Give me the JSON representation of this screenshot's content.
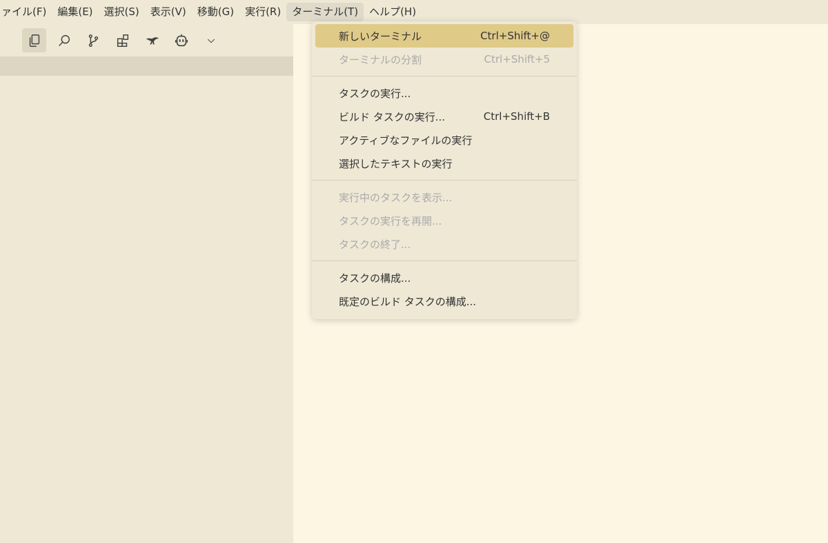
{
  "menubar": {
    "items": [
      {
        "label": "ァイル(F)"
      },
      {
        "label": "編集(E)"
      },
      {
        "label": "選択(S)"
      },
      {
        "label": "表示(V)"
      },
      {
        "label": "移動(G)"
      },
      {
        "label": "実行(R)"
      },
      {
        "label": "ターミナル(T)"
      },
      {
        "label": "ヘルプ(H)"
      }
    ]
  },
  "activity_icons": [
    "explorer-icon",
    "search-icon",
    "source-control-icon",
    "extensions-icon",
    "kangaroo-icon",
    "robot-icon",
    "chevron-down-icon"
  ],
  "terminal_menu": {
    "groups": [
      [
        {
          "label": "新しいターミナル",
          "shortcut": "Ctrl+Shift+@",
          "enabled": true,
          "highlighted": true
        },
        {
          "label": "ターミナルの分割",
          "shortcut": "Ctrl+Shift+5",
          "enabled": false
        }
      ],
      [
        {
          "label": "タスクの実行...",
          "shortcut": "",
          "enabled": true
        },
        {
          "label": "ビルド タスクの実行...",
          "shortcut": "Ctrl+Shift+B",
          "enabled": true
        },
        {
          "label": "アクティブなファイルの実行",
          "shortcut": "",
          "enabled": true
        },
        {
          "label": "選択したテキストの実行",
          "shortcut": "",
          "enabled": true
        }
      ],
      [
        {
          "label": "実行中のタスクを表示...",
          "shortcut": "",
          "enabled": false
        },
        {
          "label": "タスクの実行を再開...",
          "shortcut": "",
          "enabled": false
        },
        {
          "label": "タスクの終了...",
          "shortcut": "",
          "enabled": false
        }
      ],
      [
        {
          "label": "タスクの構成...",
          "shortcut": "",
          "enabled": true
        },
        {
          "label": "既定のビルド タスクの構成...",
          "shortcut": "",
          "enabled": true
        }
      ]
    ]
  }
}
